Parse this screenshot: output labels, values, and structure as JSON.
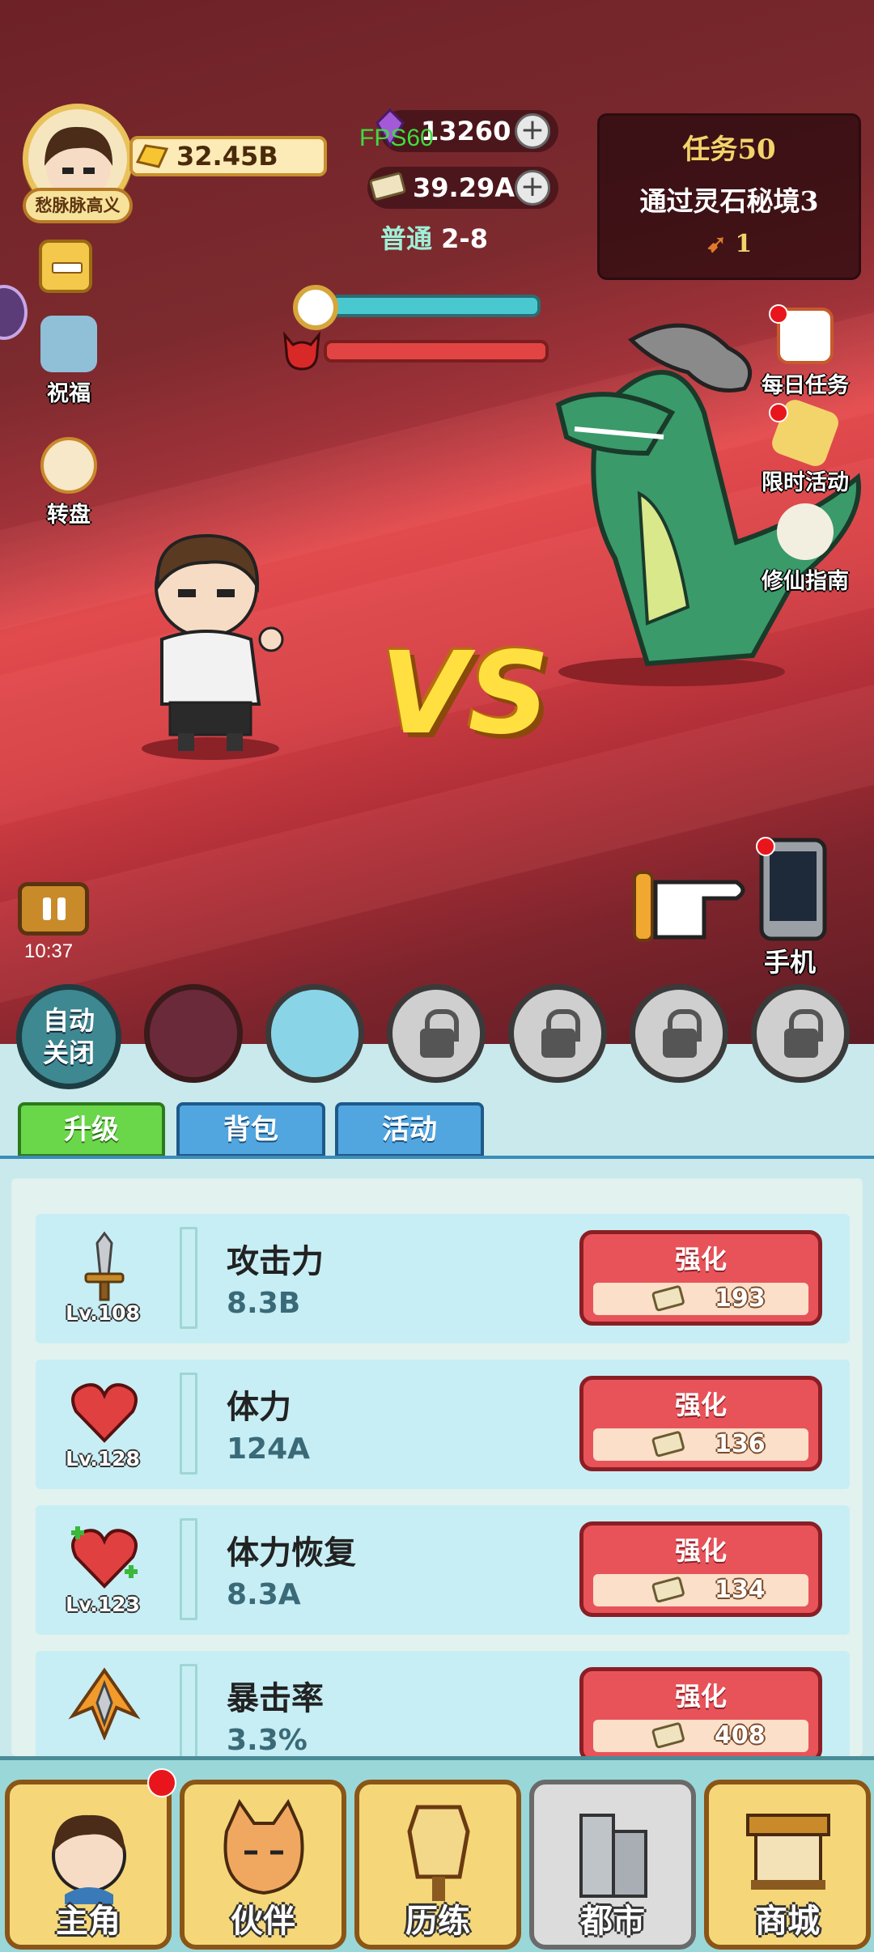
{
  "player": {
    "name": "愁脉脉高义",
    "gold": "32.45B"
  },
  "resources": {
    "gems": "13260",
    "cash": "39.29A"
  },
  "fps": "FPS60",
  "stage": {
    "mode": "普通",
    "level": "2-8"
  },
  "quest": {
    "title": "任务50",
    "desc": "通过灵石秘境3",
    "reward": "1"
  },
  "left_buttons": {
    "blessing": "祝福",
    "wheel": "转盘"
  },
  "right_buttons": {
    "daily": "每日任务",
    "limited": "限时活动",
    "guide": "修仙指南"
  },
  "vs": "VS",
  "clock": "10:37",
  "phone_label": "手机",
  "auto_toggle": {
    "line1": "自动",
    "line2": "关闭"
  },
  "tabs": [
    "升级",
    "背包",
    "活动"
  ],
  "upgrades": [
    {
      "name": "攻击力",
      "value": "8.3B",
      "level": "Lv.108",
      "button": "强化",
      "cost": "193",
      "icon": "sword-icon"
    },
    {
      "name": "体力",
      "value": "124A",
      "level": "Lv.128",
      "button": "强化",
      "cost": "136",
      "icon": "heart-icon"
    },
    {
      "name": "体力恢复",
      "value": "8.3A",
      "level": "Lv.123",
      "button": "强化",
      "cost": "134",
      "icon": "heart-plus-icon"
    },
    {
      "name": "暴击率",
      "value": "3.3%",
      "level": "",
      "button": "强化",
      "cost": "408",
      "icon": "crit-icon"
    }
  ],
  "nav": [
    "主角",
    "伙伴",
    "历练",
    "都市",
    "商城"
  ],
  "colors": {
    "accent_red": "#e8535a",
    "tab_active": "#6ad64a",
    "tab_inactive": "#52a6e0",
    "panel": "#c9e9ec"
  }
}
